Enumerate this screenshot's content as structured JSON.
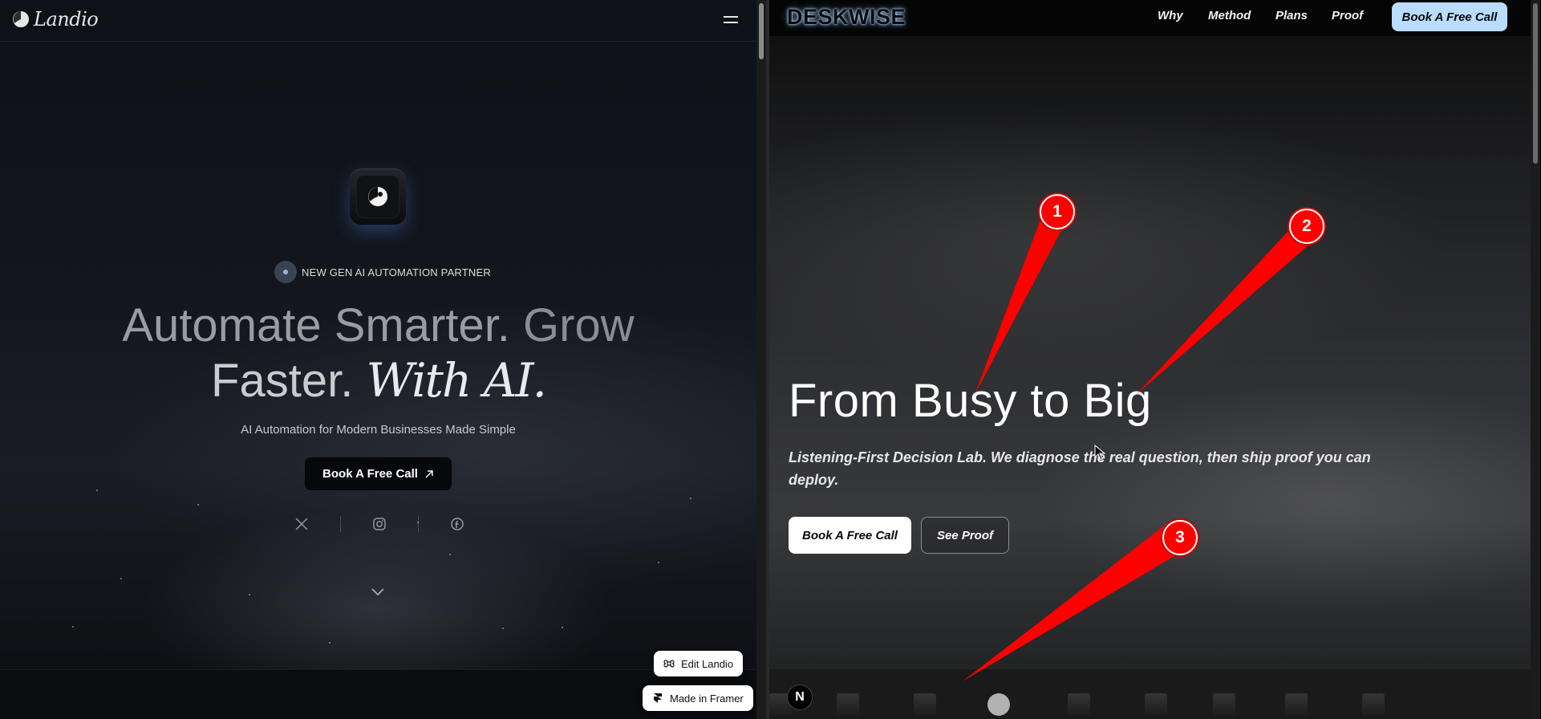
{
  "left": {
    "brand": "Landio",
    "tagline": "NEW GEN AI AUTOMATION PARTNER",
    "headline": {
      "part1": "Automate Smarter.",
      "part2": "Grow",
      "part3": "Faster.",
      "part4": "With AI."
    },
    "subtitle": "AI Automation for Modern Businesses Made Simple",
    "cta_label": "Book A Free Call",
    "socials": [
      "x-icon",
      "instagram-icon",
      "facebook-icon"
    ],
    "edit_badge": "Edit Landio",
    "framer_badge": "Made in Framer"
  },
  "right": {
    "brand": "DESKWISE",
    "nav": [
      "Why",
      "Method",
      "Plans",
      "Proof"
    ],
    "nav_cta": "Book A Free Call",
    "headline": "From Busy to Big",
    "subtitle": "Listening-First Decision Lab. We diagnose the real question, then ship proof you can deploy.",
    "primary_button": "Book A Free Call",
    "secondary_button": "See Proof",
    "next_badge": "N"
  },
  "annotations": [
    "1",
    "2",
    "3"
  ],
  "colors": {
    "nav_cta_bg": "#b9dcff",
    "annotation_red": "#ff0000",
    "left_bg": "#12151c",
    "right_bg": "#2e2f32"
  }
}
